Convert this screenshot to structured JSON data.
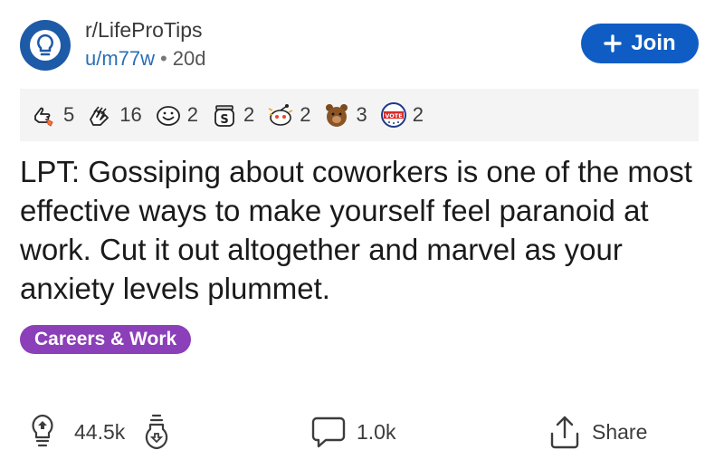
{
  "header": {
    "subreddit": "r/LifeProTips",
    "username": "u/m77w",
    "separator": "•",
    "age": "20d",
    "join_label": "Join",
    "join_icon": "plus-icon"
  },
  "awards": [
    {
      "icon": "thumbs-up-rocket-award-icon",
      "count": "5"
    },
    {
      "icon": "two-hands-award-icon",
      "count": "16"
    },
    {
      "icon": "smile-face-award-icon",
      "count": "2"
    },
    {
      "icon": "coin-jar-award-icon",
      "count": "2"
    },
    {
      "icon": "snoo-award-icon",
      "count": "2"
    },
    {
      "icon": "bear-award-icon",
      "count": "3"
    },
    {
      "icon": "vote-badge-award-icon",
      "count": "2"
    }
  ],
  "post": {
    "title": "LPT: Gossiping about coworkers is one of the most effective ways to make yourself feel paranoid at work. Cut it out altogether and marvel as your anxiety levels plummet.",
    "flair": "Careers & Work"
  },
  "actions": {
    "upvote_count": "44.5k",
    "upvote_icon": "lightbulb-up-icon",
    "downvote_icon": "lightbulb-down-icon",
    "comment_count": "1.0k",
    "comment_icon": "comment-icon",
    "share_label": "Share",
    "share_icon": "share-icon"
  },
  "colors": {
    "join_button": "#0f5dc4",
    "avatar": "#1d5aa8",
    "flair": "#8b3fb8",
    "username": "#2a6fb5",
    "awards_bar": "#f4f4f4"
  }
}
